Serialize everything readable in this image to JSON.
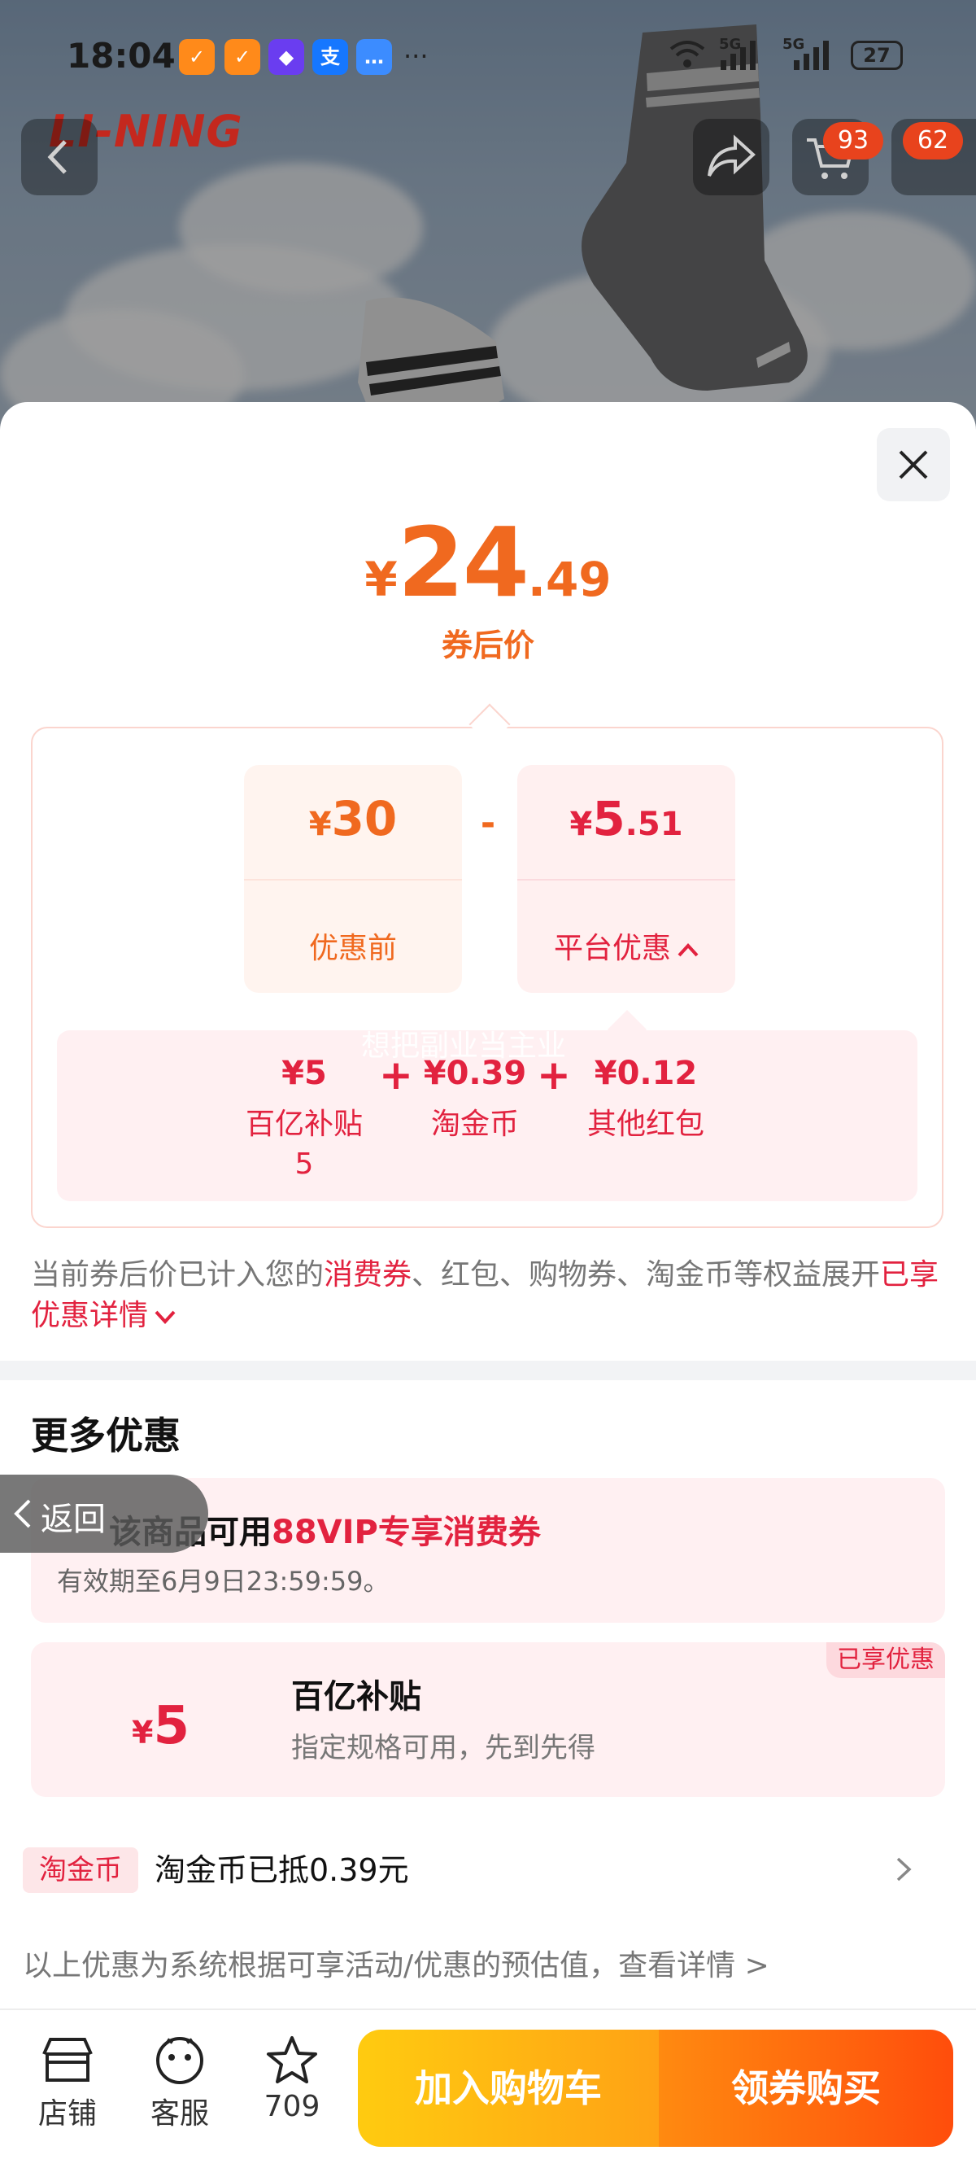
{
  "status_bar": {
    "time": "18:04",
    "battery": "27",
    "network1": "5G",
    "network2": "5G",
    "more": "···"
  },
  "hero": {
    "brand_logo": "LI-NING",
    "cart_badge": "93",
    "msg_badge": "62"
  },
  "price": {
    "symbol": "¥",
    "integer": "24",
    "decimal": ".49",
    "label": "券后价"
  },
  "calc": {
    "original": {
      "symbol": "¥",
      "value": "30",
      "label": "优惠前"
    },
    "operator": "-",
    "platform": {
      "symbol": "¥",
      "integer": "5",
      "decimal": ".51",
      "label": "平台优惠"
    },
    "items": [
      {
        "value": "¥5",
        "label": "百亿补贴",
        "sub": "5"
      },
      {
        "value": "¥0.39",
        "label": "淘金币"
      },
      {
        "value": "¥0.12",
        "label": "其他红包"
      }
    ],
    "plus": "+",
    "watermark": "想把副业当主业"
  },
  "note": {
    "prefix": "当前券后价已计入您的",
    "highlight": "消费券",
    "middle": "、红包、购物券、淘金币等权益展开",
    "link": "已享优惠详情"
  },
  "more": {
    "title": "更多优惠",
    "vip": {
      "prefix": "该商品可用",
      "highlight": "88VIP专享消费券",
      "validity": "有效期至6月9日23:59:59。"
    },
    "subsidy": {
      "symbol": "¥",
      "amount": "5",
      "title": "百亿补贴",
      "desc": "指定规格可用，先到先得",
      "badge": "已享优惠"
    },
    "coin": {
      "tag": "淘金币",
      "text": "淘金币已抵0.39元"
    },
    "footnote": "以上优惠为系统根据可享活动/优惠的预估值，查看详情 >"
  },
  "back_pill": "返回",
  "bottom": {
    "shop": "店铺",
    "service": "客服",
    "favorites": "709",
    "add_cart": "加入购物车",
    "buy": "领券购买"
  },
  "colors": {
    "orange": "#f0691f",
    "red": "#e2223f",
    "cart_btn": "#ffb412",
    "buy_btn": "#ff5a0e"
  }
}
